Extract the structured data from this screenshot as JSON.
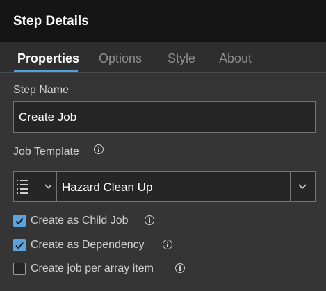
{
  "header": {
    "title": "Step Details"
  },
  "tabs": [
    {
      "label": "Properties",
      "active": true
    },
    {
      "label": "Options",
      "active": false
    },
    {
      "label": "Style",
      "active": false
    },
    {
      "label": "About",
      "active": false
    }
  ],
  "step_name": {
    "label": "Step Name",
    "value": "Create Job"
  },
  "job_template": {
    "label": "Job Template",
    "selected": "Hazard Clean Up",
    "icon": "list-icon"
  },
  "checkboxes": [
    {
      "label": "Create as Child Job",
      "checked": true
    },
    {
      "label": "Create as Dependency",
      "checked": true
    },
    {
      "label": "Create job per array item",
      "checked": false
    }
  ],
  "colors": {
    "accent": "#4fa2df",
    "checkbox_checked": "#5aa5e0",
    "header_bg": "#151515",
    "panel_bg": "#353535"
  }
}
